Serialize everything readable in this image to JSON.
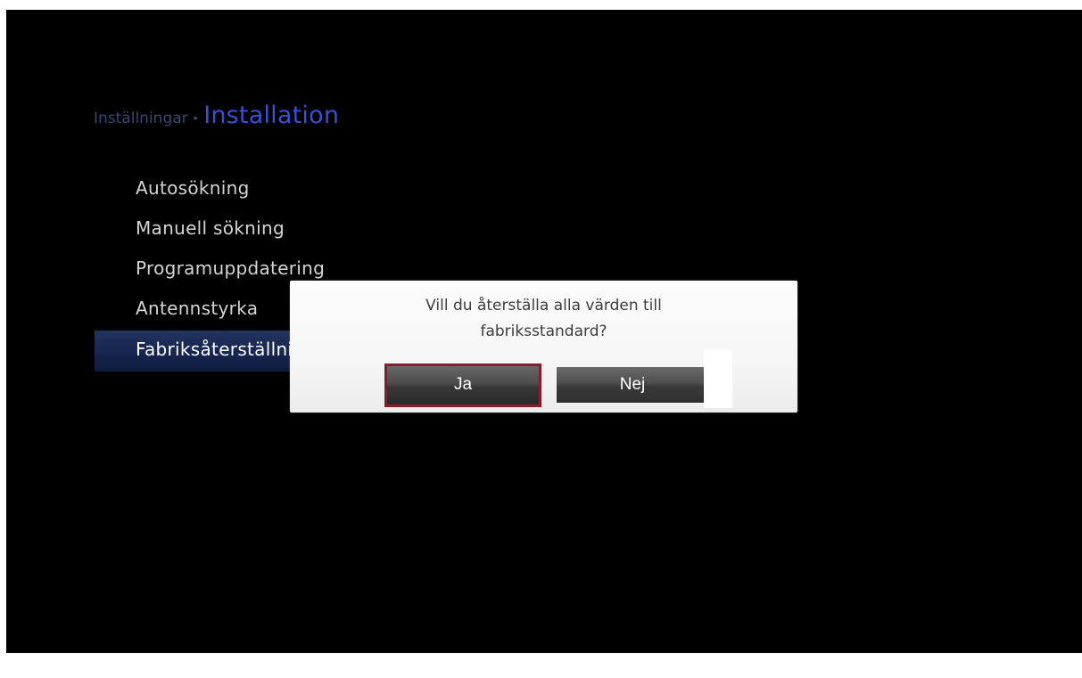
{
  "breadcrumb": {
    "parent": "Inställningar",
    "separator": "▸",
    "current": "Installation"
  },
  "menu": {
    "items": [
      {
        "label": "Autosökning"
      },
      {
        "label": "Manuell sökning"
      },
      {
        "label": "Programuppdatering"
      },
      {
        "label": "Antennstyrka"
      },
      {
        "label": "Fabriksåterställning",
        "selected": true
      }
    ]
  },
  "dialog": {
    "message_line1": "Vill du återställa alla värden till",
    "message_line2": "fabriksstandard?",
    "yes_label": "Ja",
    "no_label": "Nej",
    "focused": "Ja"
  },
  "colors": {
    "background": "#000000",
    "breadcrumb_current": "#3b4fd6",
    "selection": "#172650",
    "focus_border": "#8b1a2a"
  }
}
